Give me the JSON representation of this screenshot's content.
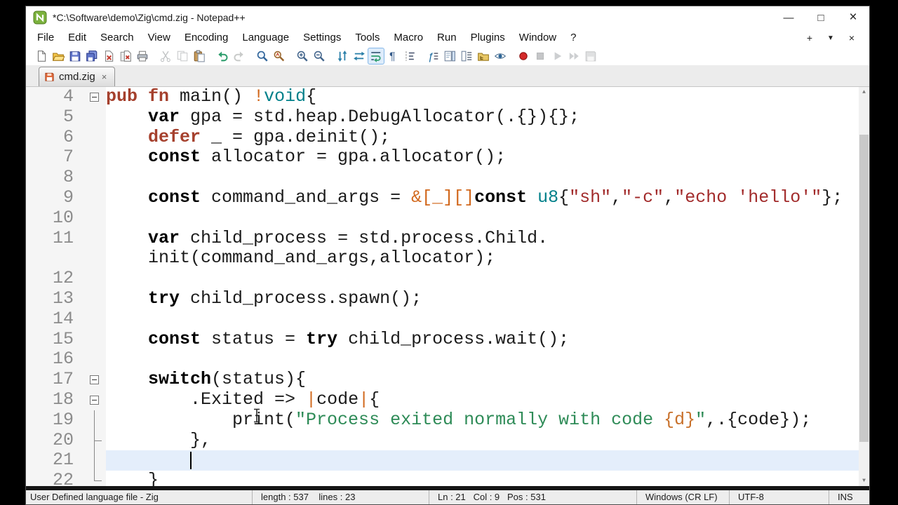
{
  "palette": {
    "kw1": "#a5402d",
    "kw2": "#000000",
    "type": "#00808a",
    "str_red": "#a22b2b",
    "str_green": "#2e8b57",
    "op": "#d2691e",
    "fmt": "#c8702a",
    "line_number": "#8c8c8c",
    "caret_line_bg": "#e4eefb"
  },
  "titlebar": {
    "title": "*C:\\Software\\demo\\Zig\\cmd.zig - Notepad++",
    "buttons": {
      "minimize": "—",
      "maximize": "□",
      "close": "×"
    }
  },
  "menubar": {
    "items": [
      "File",
      "Edit",
      "Search",
      "View",
      "Encoding",
      "Language",
      "Settings",
      "Tools",
      "Macro",
      "Run",
      "Plugins",
      "Window",
      "?"
    ],
    "extra": {
      "plus": "+",
      "list": "▼",
      "close": "×"
    }
  },
  "toolbar": {
    "groups": [
      [
        {
          "name": "new-file"
        },
        {
          "name": "open-file"
        },
        {
          "name": "save-file"
        },
        {
          "name": "save-all"
        },
        {
          "name": "close-file"
        },
        {
          "name": "close-all"
        },
        {
          "name": "print"
        }
      ],
      [
        {
          "name": "cut",
          "state": "disabled"
        },
        {
          "name": "copy",
          "state": "disabled"
        },
        {
          "name": "paste"
        }
      ],
      [
        {
          "name": "undo"
        },
        {
          "name": "redo",
          "state": "disabled"
        }
      ],
      [
        {
          "name": "find"
        },
        {
          "name": "replace"
        }
      ],
      [
        {
          "name": "zoom-in"
        },
        {
          "name": "zoom-out"
        }
      ],
      [
        {
          "name": "sync-vertical"
        },
        {
          "name": "sync-horizontal"
        },
        {
          "name": "word-wrap",
          "state": "pressed"
        },
        {
          "name": "show-all-characters"
        },
        {
          "name": "indent-guide"
        }
      ],
      [
        {
          "name": "function-list"
        },
        {
          "name": "document-map"
        },
        {
          "name": "document-list"
        },
        {
          "name": "folder-as-workspace"
        },
        {
          "name": "file-monitoring"
        }
      ],
      [
        {
          "name": "record-macro"
        },
        {
          "name": "stop-macro",
          "state": "disabled"
        },
        {
          "name": "play-macro",
          "state": "disabled"
        },
        {
          "name": "run-macro-multiple",
          "state": "disabled"
        },
        {
          "name": "save-macro",
          "state": "disabled"
        }
      ]
    ]
  },
  "tab": {
    "label": "cmd.zig",
    "modified": true,
    "close_glyph": "×"
  },
  "editor": {
    "lines": [
      {
        "num": "4",
        "fold": "box",
        "seg": [
          [
            "pub fn ",
            "kw1"
          ],
          [
            "main() ",
            ""
          ],
          [
            "!",
            "op"
          ],
          [
            "void",
            "type"
          ],
          [
            "{",
            ""
          ]
        ]
      },
      {
        "num": "5",
        "seg": [
          [
            "    ",
            ""
          ],
          [
            "var ",
            "kw2"
          ],
          [
            "gpa = std.heap.DebugAllocator(.{}){};",
            ""
          ]
        ]
      },
      {
        "num": "6",
        "seg": [
          [
            "    ",
            ""
          ],
          [
            "defer ",
            "kw1"
          ],
          [
            "_ = gpa.deinit();",
            ""
          ]
        ]
      },
      {
        "num": "7",
        "seg": [
          [
            "    ",
            ""
          ],
          [
            "const ",
            "kw2"
          ],
          [
            "allocator = gpa.allocator();",
            ""
          ]
        ]
      },
      {
        "num": "8",
        "seg": []
      },
      {
        "num": "9",
        "seg": [
          [
            "    ",
            ""
          ],
          [
            "const ",
            "kw2"
          ],
          [
            "command_and_args = ",
            ""
          ],
          [
            "&[_][]",
            "op"
          ],
          [
            "const ",
            "kw2"
          ],
          [
            "u8",
            "type"
          ],
          [
            "{",
            ""
          ],
          [
            "\"sh\"",
            "str"
          ],
          [
            ",",
            ""
          ],
          [
            "\"-c\"",
            "str"
          ],
          [
            ",",
            ""
          ],
          [
            "\"echo 'hello'\"",
            "str"
          ],
          [
            "};",
            ""
          ]
        ]
      },
      {
        "num": "10",
        "seg": []
      },
      {
        "num": "11",
        "seg": [
          [
            "    ",
            ""
          ],
          [
            "var ",
            "kw2"
          ],
          [
            "child_process = std.process.Child.",
            ""
          ]
        ]
      },
      {
        "num": "",
        "seg": [
          [
            "    init(command_and_args,allocator);",
            ""
          ]
        ]
      },
      {
        "num": "12",
        "seg": []
      },
      {
        "num": "13",
        "seg": [
          [
            "    ",
            ""
          ],
          [
            "try ",
            "kw2"
          ],
          [
            "child_process.spawn();",
            ""
          ]
        ]
      },
      {
        "num": "14",
        "seg": []
      },
      {
        "num": "15",
        "seg": [
          [
            "    ",
            ""
          ],
          [
            "const ",
            "kw2"
          ],
          [
            "status = ",
            ""
          ],
          [
            "try ",
            "kw2"
          ],
          [
            "child_process.wait();",
            ""
          ]
        ]
      },
      {
        "num": "16",
        "seg": []
      },
      {
        "num": "17",
        "fold": "box",
        "seg": [
          [
            "    ",
            ""
          ],
          [
            "switch",
            "kw2"
          ],
          [
            "(status){",
            ""
          ]
        ]
      },
      {
        "num": "18",
        "fold": "box",
        "seg": [
          [
            "        .Exited => ",
            ""
          ],
          [
            "|",
            "op"
          ],
          [
            "code",
            ""
          ],
          [
            "|",
            "op"
          ],
          [
            "{",
            ""
          ]
        ]
      },
      {
        "num": "19",
        "fold": "line",
        "seg": [
          [
            "            print(",
            ""
          ],
          [
            "\"Process exited normally with code ",
            "strg"
          ],
          [
            "{d}",
            "fmt"
          ],
          [
            "\"",
            "strg"
          ],
          [
            ",.{code});",
            ""
          ]
        ]
      },
      {
        "num": "20",
        "fold": "endmid",
        "seg": [
          [
            "        },",
            ""
          ]
        ]
      },
      {
        "num": "21",
        "fold": "line",
        "current": true,
        "caret_col": 9,
        "seg": []
      },
      {
        "num": "22",
        "fold": "end",
        "seg": [
          [
            "    }",
            ""
          ]
        ]
      }
    ]
  },
  "statusbar": {
    "doc_type": "User Defined language file - Zig",
    "length_lines": "length : 537    lines : 23",
    "position": "Ln : 21   Col : 9   Pos : 531",
    "eol": "Windows (CR LF)",
    "encoding": "UTF-8",
    "typing_mode": "INS"
  }
}
